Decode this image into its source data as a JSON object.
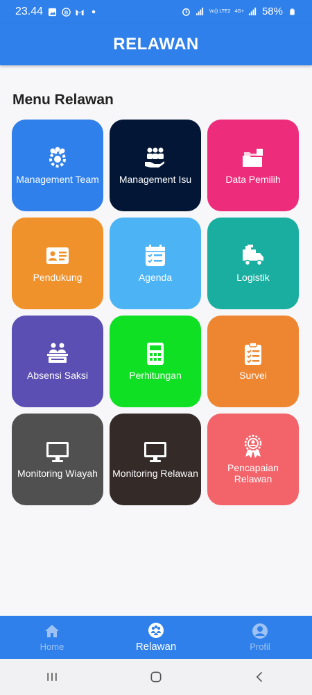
{
  "status_bar": {
    "time": "23.44",
    "battery": "58%",
    "network_1": "Vo)) LTE2",
    "network_2": "4G+",
    "icons": [
      "image-icon",
      "b-circle-icon",
      "gmail-icon",
      "dot-icon",
      "alarm-icon",
      "signal-icon",
      "battery-icon"
    ]
  },
  "app_bar": {
    "title": "RELAWAN"
  },
  "section": {
    "title": "Menu Relawan"
  },
  "menu": [
    {
      "label": "Management Team",
      "color": "#2f80ea",
      "icon": "team-gear-icon"
    },
    {
      "label": "Management Isu",
      "color": "#031635",
      "icon": "people-hand-icon"
    },
    {
      "label": "Data Pemilih",
      "color": "#ed2d7b",
      "icon": "folders-icon"
    },
    {
      "label": "Pendukung",
      "color": "#f0922b",
      "icon": "id-card-icon"
    },
    {
      "label": "Agenda",
      "color": "#4cb4f5",
      "icon": "calendar-check-icon"
    },
    {
      "label": "Logistik",
      "color": "#1aaea0",
      "icon": "truck-icon"
    },
    {
      "label": "Absensi Saksi",
      "color": "#5b4fb3",
      "icon": "meeting-table-icon"
    },
    {
      "label": "Perhitungan",
      "color": "#10e024",
      "icon": "calculator-icon"
    },
    {
      "label": "Survei",
      "color": "#ee8631",
      "icon": "clipboard-check-icon"
    },
    {
      "label": "Monitoring Wiayah",
      "color": "#505050",
      "icon": "monitor-icon"
    },
    {
      "label": "Monitoring Relawan",
      "color": "#342a28",
      "icon": "monitor-icon"
    },
    {
      "label": "Pencapaian Relawan",
      "color": "#f2636a",
      "icon": "award-icon"
    }
  ],
  "bottom_nav": {
    "items": [
      {
        "label": "Home",
        "icon": "home-icon",
        "active": false
      },
      {
        "label": "Relawan",
        "icon": "relawan-icon",
        "active": true
      },
      {
        "label": "Profil",
        "icon": "profile-icon",
        "active": false
      }
    ]
  },
  "system_nav": [
    "recent-apps-icon",
    "home-button-icon",
    "back-icon"
  ]
}
